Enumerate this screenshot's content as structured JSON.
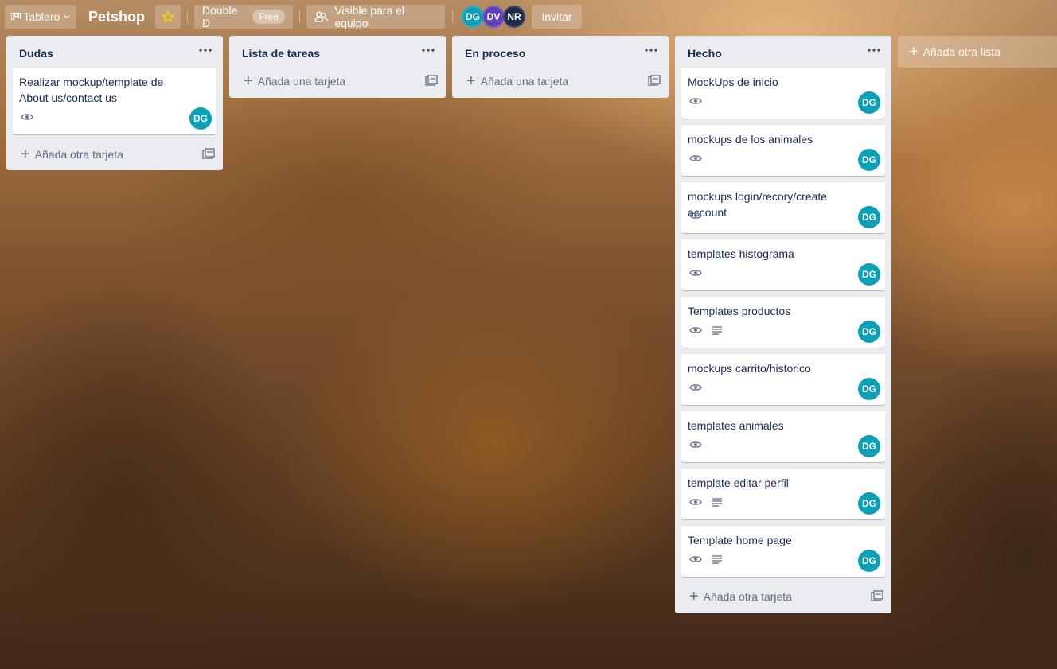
{
  "header": {
    "board_switcher_label": "Tablero",
    "board_title": "Petshop",
    "team_name": "Double D",
    "team_plan": "Free",
    "visibility_label": "Visible para el equipo",
    "members": [
      {
        "initials": "DG",
        "color": "#0aa0b8"
      },
      {
        "initials": "DV",
        "color": "#5f3fbe"
      },
      {
        "initials": "NR",
        "color": "#1c2b4a"
      }
    ],
    "invite_label": "Invitar"
  },
  "lists": [
    {
      "title": "Dudas",
      "cards": [
        {
          "title": "Realizar mockup/template de About us/contact us",
          "avatar": "DG",
          "has_description": false
        }
      ],
      "add_card_label": "Añada otra tarjeta"
    },
    {
      "title": "Lista de tareas",
      "cards": [],
      "add_card_label": "Añada una tarjeta"
    },
    {
      "title": "En proceso",
      "cards": [],
      "add_card_label": "Añada una tarjeta"
    },
    {
      "title": "Hecho",
      "cards": [
        {
          "title": "MockUps de inicio",
          "avatar": "DG",
          "has_description": false
        },
        {
          "title": "mockups de los animales",
          "avatar": "DG",
          "has_description": false
        },
        {
          "title": "mockups login/recory/create account",
          "avatar": "DG",
          "has_description": false
        },
        {
          "title": "templates histograma",
          "avatar": "DG",
          "has_description": false
        },
        {
          "title": "Templates productos",
          "avatar": "DG",
          "has_description": true
        },
        {
          "title": "mockups carrito/historico",
          "avatar": "DG",
          "has_description": false
        },
        {
          "title": "templates animales",
          "avatar": "DG",
          "has_description": false
        },
        {
          "title": "template editar perfil",
          "avatar": "DG",
          "has_description": true
        },
        {
          "title": "Template home page",
          "avatar": "DG",
          "has_description": true
        }
      ],
      "add_card_label": "Añada otra tarjeta"
    }
  ],
  "add_list_label": "Añada otra lista",
  "colors": {
    "list_bg": "#ebecf0",
    "avatar_teal": "#0aa0b8",
    "star": "#f2d600"
  }
}
